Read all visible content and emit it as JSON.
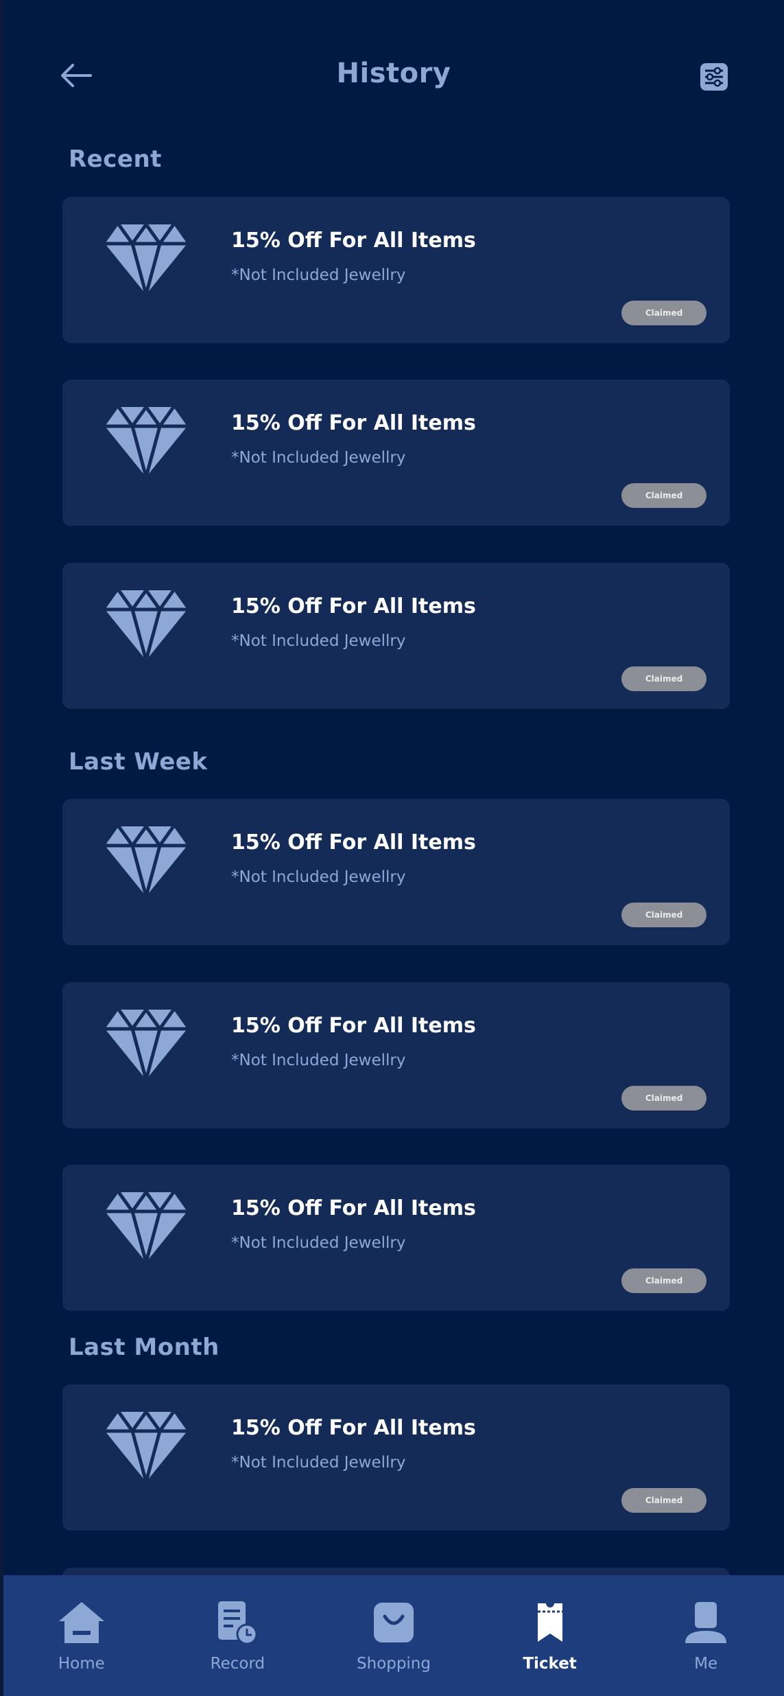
{
  "header": {
    "title": "History",
    "back_icon": "back-arrow-icon",
    "filter_icon": "filter-icon"
  },
  "sections": [
    {
      "label": "Recent",
      "cards": [
        {
          "title": "15% Off For All Items",
          "subtitle": "*Not Included Jewellry",
          "status": "Claimed"
        },
        {
          "title": "15% Off For All Items",
          "subtitle": "*Not Included Jewellry",
          "status": "Claimed"
        },
        {
          "title": "15% Off For All Items",
          "subtitle": "*Not Included Jewellry",
          "status": "Claimed"
        }
      ]
    },
    {
      "label": "Last Week",
      "cards": [
        {
          "title": "15% Off For All Items",
          "subtitle": "*Not Included Jewellry",
          "status": "Claimed"
        },
        {
          "title": "15% Off For All Items",
          "subtitle": "*Not Included Jewellry",
          "status": "Claimed"
        },
        {
          "title": "15% Off For All Items",
          "subtitle": "*Not Included Jewellry",
          "status": "Claimed"
        }
      ]
    },
    {
      "label": "Last Month",
      "cards": [
        {
          "title": "15% Off For All Items",
          "subtitle": "*Not Included Jewellry",
          "status": "Claimed"
        }
      ]
    }
  ],
  "nav": {
    "items": [
      {
        "label": "Home",
        "icon": "home-icon"
      },
      {
        "label": "Record",
        "icon": "record-icon"
      },
      {
        "label": "Shopping",
        "icon": "shopping-bag-icon"
      },
      {
        "label": "Ticket",
        "icon": "ticket-icon"
      },
      {
        "label": "Me",
        "icon": "profile-icon"
      }
    ],
    "active": "Ticket"
  },
  "colors": {
    "background": "#001a44",
    "card": "#142b57",
    "accent": "#8ea8d6",
    "nav_background": "#1e3d7c",
    "badge": "#8c8f95"
  }
}
